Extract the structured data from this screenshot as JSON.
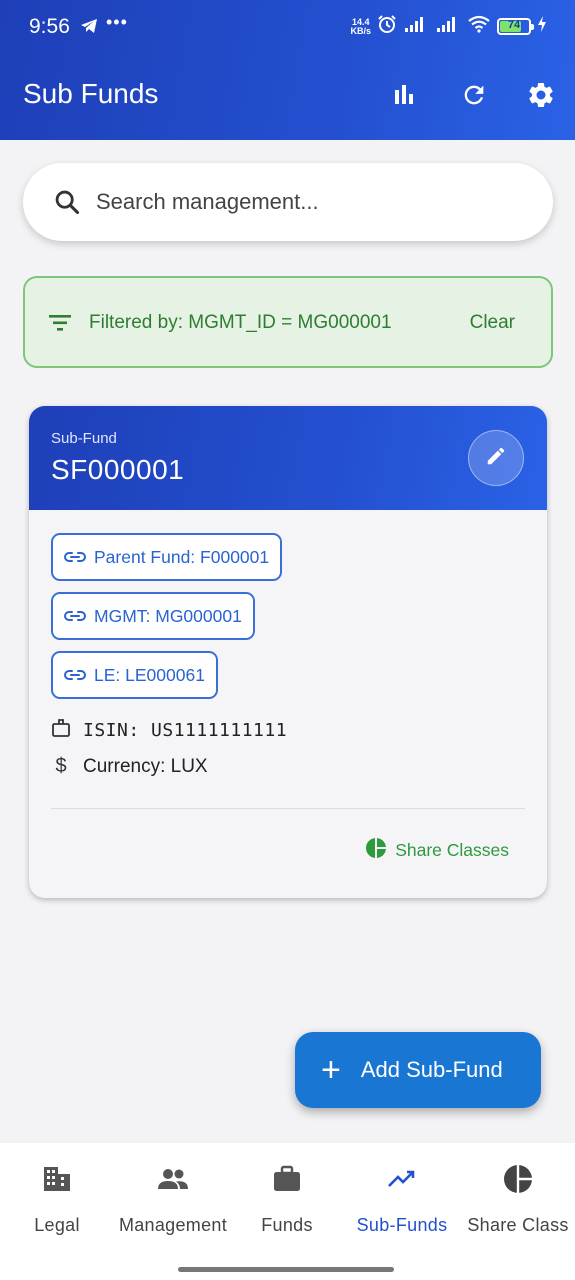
{
  "status_bar": {
    "time": "9:56",
    "more": "•••",
    "net_speed_value": "14.4",
    "net_speed_unit": "KB/s",
    "battery": "74"
  },
  "app_bar": {
    "title": "Sub Funds",
    "icons": [
      "bar-chart-icon",
      "refresh-icon",
      "settings-icon"
    ]
  },
  "search": {
    "placeholder": "Search management..."
  },
  "filter": {
    "text": "Filtered by: MGMT_ID = MG000001",
    "clear_label": "Clear"
  },
  "card": {
    "type_label": "Sub-Fund",
    "id": "SF000001",
    "chips": [
      {
        "label": "Parent Fund: F000001"
      },
      {
        "label": "MGMT: MG000001"
      },
      {
        "label": "LE: LE000061"
      }
    ],
    "isin": "ISIN: US1111111111",
    "currency": "Currency: LUX",
    "share_classes_label": "Share Classes"
  },
  "fab": {
    "label": "Add Sub-Fund"
  },
  "bottom_nav": {
    "items": [
      {
        "label": "Legal",
        "icon": "building-icon"
      },
      {
        "label": "Management",
        "icon": "people-icon"
      },
      {
        "label": "Funds",
        "icon": "briefcase-icon"
      },
      {
        "label": "Sub-Funds",
        "icon": "trending-up-icon"
      },
      {
        "label": "Share Class",
        "icon": "pie-chart-icon"
      }
    ],
    "active": "Sub-Funds"
  },
  "colors": {
    "primary": "#2450d0",
    "filter_green": "#2e7d32",
    "fab_blue": "#1976d2"
  }
}
